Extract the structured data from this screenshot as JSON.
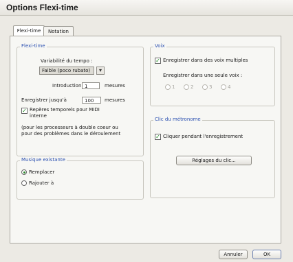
{
  "window": {
    "title": "Options Flexi-time"
  },
  "tabs": [
    {
      "label": "Flexi-time",
      "active": true
    },
    {
      "label": "Notation",
      "active": false
    }
  ],
  "flexitime": {
    "group_label": "Flexi-time",
    "tempo_label": "Variabilité du tempo :",
    "tempo_value": "Faible (poco rubato)",
    "intro_label": "Introduction",
    "intro_value": "1",
    "intro_unit": "mesures",
    "record_label": "Enregistrer jusqu'à",
    "record_value": "100",
    "record_unit": "mesures",
    "midi_checkbox_line1": "Repères temporels pour MIDI",
    "midi_checkbox_line2": "interne",
    "midi_checked": true,
    "note_line1": "(pour les processeurs à double coeur ou",
    "note_line2": "pour des problèmes dans le déroulement"
  },
  "existing_music": {
    "group_label": "Musique existante",
    "options": [
      {
        "label": "Remplacer",
        "selected": true
      },
      {
        "label": "Rajouter à",
        "selected": false
      }
    ]
  },
  "voices": {
    "group_label": "Voix",
    "multi_voice_label": "Enregistrer dans des voix multiples",
    "multi_voice_checked": true,
    "single_voice_label": "Enregistrer dans une seule voix :",
    "voice_options": [
      "1",
      "2",
      "3",
      "4"
    ]
  },
  "metronome": {
    "group_label": "Clic du métronome",
    "click_label": "Cliquer pendant l'enregistrement",
    "click_checked": true,
    "settings_button": "Réglages du clic..."
  },
  "footer": {
    "cancel": "Annuler",
    "ok": "OK"
  },
  "glyphs": {
    "check": "✓",
    "dropdown": "▾"
  }
}
